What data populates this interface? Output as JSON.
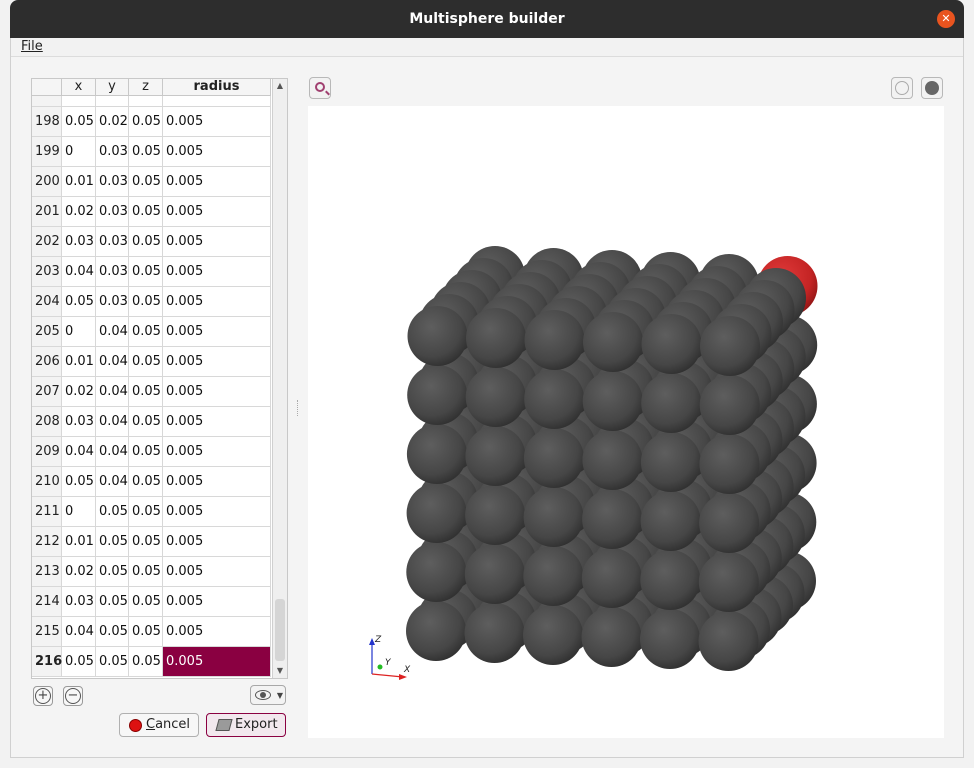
{
  "window": {
    "title": "Multisphere builder"
  },
  "menu": {
    "file_label": "File"
  },
  "table": {
    "headers": [
      "",
      "x",
      "y",
      "z",
      "radius"
    ],
    "partial_row_index": "197",
    "rows": [
      {
        "i": "198",
        "x": "0.05",
        "y": "0.02",
        "z": "0.05",
        "r": "0.005"
      },
      {
        "i": "199",
        "x": "0",
        "y": "0.03",
        "z": "0.05",
        "r": "0.005"
      },
      {
        "i": "200",
        "x": "0.01",
        "y": "0.03",
        "z": "0.05",
        "r": "0.005"
      },
      {
        "i": "201",
        "x": "0.02",
        "y": "0.03",
        "z": "0.05",
        "r": "0.005"
      },
      {
        "i": "202",
        "x": "0.03",
        "y": "0.03",
        "z": "0.05",
        "r": "0.005"
      },
      {
        "i": "203",
        "x": "0.04",
        "y": "0.03",
        "z": "0.05",
        "r": "0.005"
      },
      {
        "i": "204",
        "x": "0.05",
        "y": "0.03",
        "z": "0.05",
        "r": "0.005"
      },
      {
        "i": "205",
        "x": "0",
        "y": "0.04",
        "z": "0.05",
        "r": "0.005"
      },
      {
        "i": "206",
        "x": "0.01",
        "y": "0.04",
        "z": "0.05",
        "r": "0.005"
      },
      {
        "i": "207",
        "x": "0.02",
        "y": "0.04",
        "z": "0.05",
        "r": "0.005"
      },
      {
        "i": "208",
        "x": "0.03",
        "y": "0.04",
        "z": "0.05",
        "r": "0.005"
      },
      {
        "i": "209",
        "x": "0.04",
        "y": "0.04",
        "z": "0.05",
        "r": "0.005"
      },
      {
        "i": "210",
        "x": "0.05",
        "y": "0.04",
        "z": "0.05",
        "r": "0.005"
      },
      {
        "i": "211",
        "x": "0",
        "y": "0.05",
        "z": "0.05",
        "r": "0.005"
      },
      {
        "i": "212",
        "x": "0.01",
        "y": "0.05",
        "z": "0.05",
        "r": "0.005"
      },
      {
        "i": "213",
        "x": "0.02",
        "y": "0.05",
        "z": "0.05",
        "r": "0.005"
      },
      {
        "i": "214",
        "x": "0.03",
        "y": "0.05",
        "z": "0.05",
        "r": "0.005"
      },
      {
        "i": "215",
        "x": "0.04",
        "y": "0.05",
        "z": "0.05",
        "r": "0.005"
      },
      {
        "i": "216",
        "x": "0.05",
        "y": "0.05",
        "z": "0.05",
        "r": "0.005"
      }
    ],
    "selected_row": "216"
  },
  "controls": {
    "add_icon": "plus-circle-icon",
    "remove_icon": "minus-circle-icon",
    "view_icon": "eye-icon",
    "cancel_label": "Cancel",
    "export_label": "Export"
  },
  "viewer": {
    "tools": [
      "zoom-to-fit-icon",
      "globe-icon",
      "sphere-icon"
    ],
    "sphere_color": "#4b4b4b",
    "highlight_color": "#cc2222",
    "axes": {
      "x": "X",
      "y": "Y",
      "z": "Z"
    },
    "colors": {
      "x": "#dd2222",
      "y": "#22bb22",
      "z": "#2233cc"
    }
  }
}
